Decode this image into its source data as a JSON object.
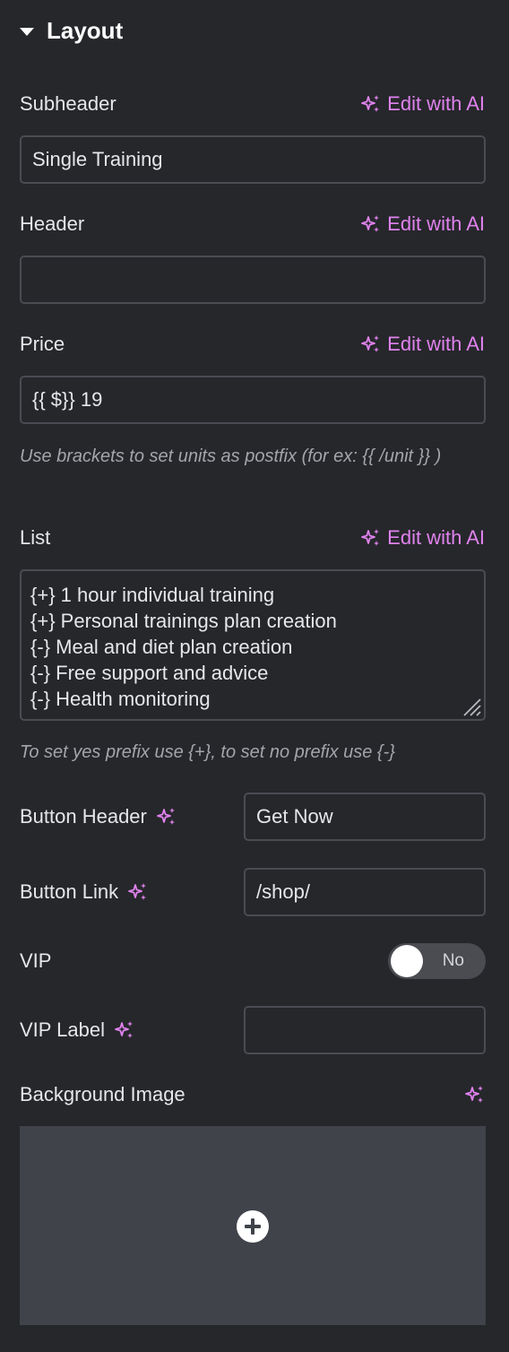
{
  "section": {
    "title": "Layout"
  },
  "ai_link_label": "Edit with AI",
  "fields": {
    "subheader": {
      "label": "Subheader",
      "value": "Single Training"
    },
    "header": {
      "label": "Header",
      "value": ""
    },
    "price": {
      "label": "Price",
      "value": "{{ $}} 19",
      "hint": "Use brackets to set units as postfix (for ex: {{ /unit }} )"
    },
    "list": {
      "label": "List",
      "lines": [
        "{+} 1 hour individual training",
        "{+} Personal trainings plan creation",
        "{-} Meal and diet plan creation",
        "{-} Free support and advice",
        "{-} Health monitoring"
      ],
      "hint": "To set yes prefix use {+}, to set no prefix use {-}"
    },
    "button_header": {
      "label": "Button Header",
      "value": "Get Now"
    },
    "button_link": {
      "label": "Button Link",
      "value": "/shop/"
    },
    "vip": {
      "label": "VIP",
      "toggle_text": "No",
      "enabled": false
    },
    "vip_label": {
      "label": "VIP Label",
      "value": ""
    },
    "background_image": {
      "label": "Background Image"
    }
  },
  "colors": {
    "background": "#26272b",
    "accent_ai": "#e082ee",
    "input_border": "#4a4c52",
    "image_placeholder": "#40434a"
  },
  "icons": {
    "section_toggle": "caret-down-icon",
    "ai": "sparkle-icon",
    "add_image": "plus-circle-icon",
    "resize": "resize-grip-icon"
  }
}
